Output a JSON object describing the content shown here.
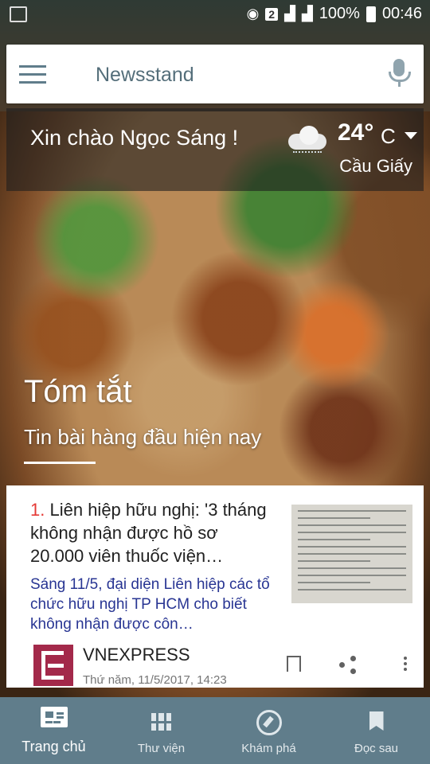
{
  "status_bar": {
    "sim": "2",
    "battery": "100%",
    "time": "00:46"
  },
  "search": {
    "title": "Newsstand"
  },
  "greeting": {
    "text": "Xin chào Ngọc Sáng !",
    "temperature": "24°",
    "unit": "C",
    "location": "Cầu Giấy"
  },
  "section": {
    "title": "Tóm tắt",
    "subtitle": "Tin bài hàng đầu hiện nay"
  },
  "article": {
    "number": "1.",
    "title": "Liên hiệp hữu nghị: '3 tháng không nhận được hồ sơ 20.000 viên thuốc viện…",
    "description": "Sáng 11/5, đại diện Liên hiệp các tổ chức hữu nghị TP HCM cho biết không nhận được côn…",
    "source": "VNEXPRESS",
    "date": "Thứ năm, 11/5/2017, 14:23"
  },
  "bottom_nav": {
    "items": [
      {
        "label": "Trang chủ",
        "icon": "home-news-icon",
        "active": true
      },
      {
        "label": "Thư viện",
        "icon": "grid-icon",
        "active": false
      },
      {
        "label": "Khám phá",
        "icon": "compass-icon",
        "active": false
      },
      {
        "label": "Đọc sau",
        "icon": "bookmark-icon",
        "active": false
      }
    ]
  },
  "colors": {
    "nav_bg": "#607d8b",
    "article_number": "#e53935",
    "article_desc": "#283593",
    "source_logo": "#a3294a"
  }
}
